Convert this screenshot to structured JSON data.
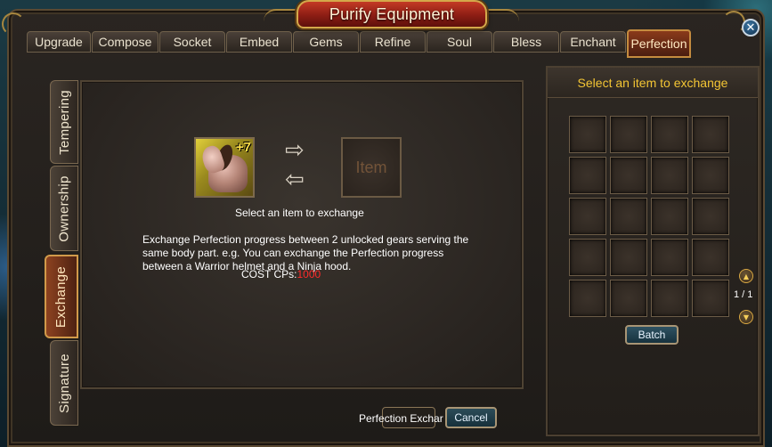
{
  "window": {
    "title": "Purify Equipment"
  },
  "top_tabs": [
    {
      "label": "Upgrade"
    },
    {
      "label": "Compose"
    },
    {
      "label": "Socket"
    },
    {
      "label": "Embed"
    },
    {
      "label": "Gems"
    },
    {
      "label": "Refine"
    },
    {
      "label": "Soul"
    },
    {
      "label": "Bless"
    },
    {
      "label": "Enchant"
    },
    {
      "label": "Perfection",
      "active": true
    }
  ],
  "side_tabs": [
    {
      "label": "Tempering"
    },
    {
      "label": "Ownership"
    },
    {
      "label": "Exchange",
      "active": true
    },
    {
      "label": "Signature"
    }
  ],
  "exchange": {
    "source_item": {
      "icon": "horse-mount-icon",
      "plus": "+7"
    },
    "target_item": {
      "watermark": "Item"
    },
    "select_label": "Select an item to exchange",
    "description": "Exchange Perfection progress between 2 unlocked gears serving the same body part. e.g. You can exchange the Perfection progress between a Warrior helmet and a Ninja hood.",
    "cost_label": "COST CPs:",
    "cost_value": "1000"
  },
  "buttons": {
    "exchange_label": "Perfection Exchar",
    "cancel": "Cancel",
    "batch": "Batch"
  },
  "inventory": {
    "header": "Select an item to exchange",
    "slots": 20,
    "page": "1 / 1"
  },
  "colors": {
    "accent_gold": "#f3c534",
    "cost_red": "#ff2a2a",
    "active_tab": "#8a3a1a"
  }
}
